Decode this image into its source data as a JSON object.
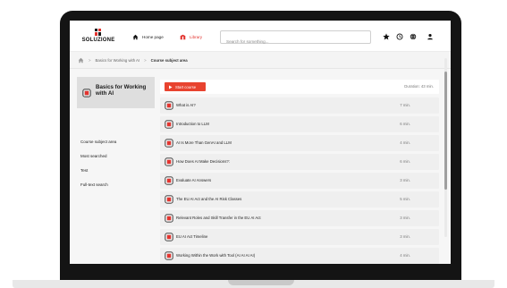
{
  "app": {
    "logo_text": "SOLUZIONE",
    "brand_colors": {
      "dark": "#1a1a1a",
      "accent": "#e3342f"
    }
  },
  "nav": {
    "home_label": "Home page",
    "library_label": "Library"
  },
  "search": {
    "placeholder": "Search for something..."
  },
  "top_icons": [
    "star-icon",
    "history-icon",
    "globe-icon",
    "user-icon"
  ],
  "breadcrumb": {
    "level1": "Basics for Working with AI",
    "current": "Course subject area"
  },
  "course": {
    "title": "Basics for Working with AI",
    "start_label": "Start course",
    "duration": "Duration: 43 min."
  },
  "sidebar_links": [
    "Course subject area",
    "Most searched",
    "Test",
    "Full-text search"
  ],
  "lessons": [
    {
      "title": "What is AI?",
      "time": "7 min."
    },
    {
      "title": "Introduction to LLM",
      "time": "6 min."
    },
    {
      "title": "AI Is More Than GenAI and LLM",
      "time": "4 min."
    },
    {
      "title": "How Does AI Make Decisions?:",
      "time": "6 min."
    },
    {
      "title": "Evaluate AI Answers",
      "time": "3 min."
    },
    {
      "title": "The EU AI Act and the AI Risk Classes",
      "time": "5 min."
    },
    {
      "title": "Relevant Roles and Skill Transfer in the EU AI Act",
      "time": "3 min."
    },
    {
      "title": "EU AI Act Timeline",
      "time": "3 min."
    },
    {
      "title": "Working Within the Work with Tool (AI AI AI AI)",
      "time": "4 min."
    }
  ]
}
